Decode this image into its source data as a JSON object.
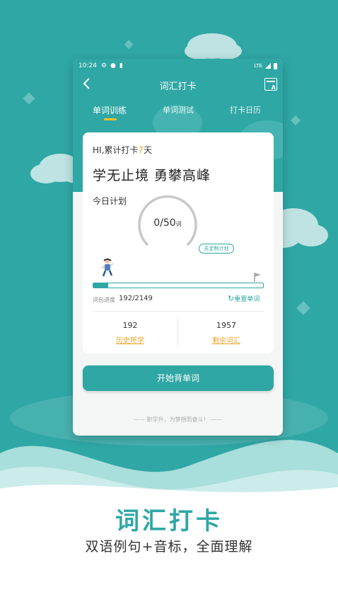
{
  "status_bar": {
    "time": "10:24",
    "network": "LTE"
  },
  "nav": {
    "title": "词汇打卡"
  },
  "tabs": [
    {
      "label": "单词训练",
      "active": true
    },
    {
      "label": "单词测试",
      "active": false
    },
    {
      "label": "打卡日历",
      "active": false
    }
  ],
  "card": {
    "greeting_prefix": "HI,累计打卡",
    "greeting_days": "7",
    "greeting_suffix": "天",
    "motto": "学无止境 勇攀高峰",
    "plan_label": "今日计划",
    "plan_progress": "0/50",
    "plan_unit": "词",
    "custom_plan": "去定制计划",
    "package_label": "词包进度",
    "package_value": "192/2149",
    "package_fraction": 0.089,
    "reset_label": "重置单词",
    "stats": [
      {
        "value": "192",
        "label": "历史所学"
      },
      {
        "value": "1957",
        "label": "剩余词汇"
      }
    ]
  },
  "start_button": "开始背单词",
  "slogan": "—— 职学升，为梦想而奋斗！ ——",
  "promo": {
    "title": "词汇打卡",
    "subtitle": "双语例句+音标，全面理解"
  },
  "colors": {
    "teal": "#2fa7a5",
    "accent": "#e8a628",
    "tab_underline": "#f5c228"
  }
}
